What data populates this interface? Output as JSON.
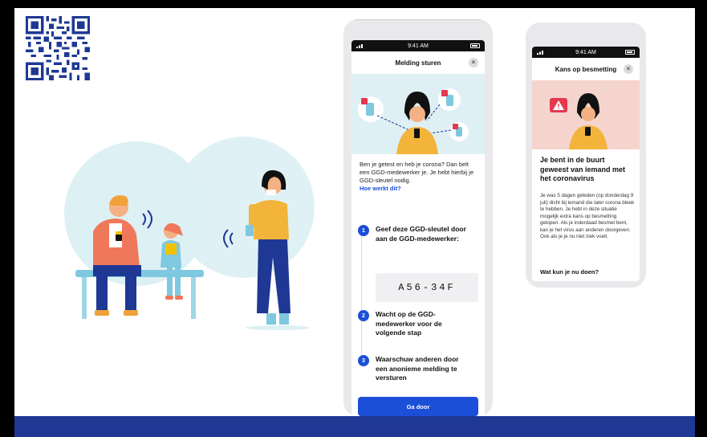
{
  "colors": {
    "accent": "#1b4fd8",
    "footer": "#1e3894",
    "hero_blue": "#dff0f5",
    "hero_red": "#f5d4ce",
    "circle": "#ddf0f4",
    "alert": "#e5384f"
  },
  "phone1": {
    "time": "9:41 AM",
    "title": "Melding sturen",
    "close_icon": "×",
    "intro": "Ben je getest en heb je corona? Dan belt een GGD-medewerker je. Je hebt hierbij je GGD-sleutel nodig.",
    "link": "Hoe werkt dit?",
    "steps": [
      {
        "num": "1",
        "text": "Geef deze GGD-sleutel door aan de GGD-medewerker:"
      },
      {
        "num": "2",
        "text": "Wacht op de GGD-medewerker voor de volgende stap"
      },
      {
        "num": "3",
        "text": "Waarschuw anderen door een anonieme melding te versturen"
      }
    ],
    "code": "A56-34F",
    "button": "Ga door"
  },
  "phone2": {
    "time": "9:41 AM",
    "title": "Kans op besmetting",
    "close_icon": "×",
    "heading": "Je bent in de buurt geweest van iemand met het coronavirus",
    "body": "Je was 5 dagen geleden (op donderdag 9 juli) dicht bij iemand die later corona bleek te hebben. Je hebt in deze situatie mogelijk extra kans op besmetting gelopen. Als je inderdaad besmet bent, kan je het virus aan anderen doorgeven. Ook als je je nu niet ziek voelt.",
    "subheading": "Wat kun je nu doen?"
  }
}
